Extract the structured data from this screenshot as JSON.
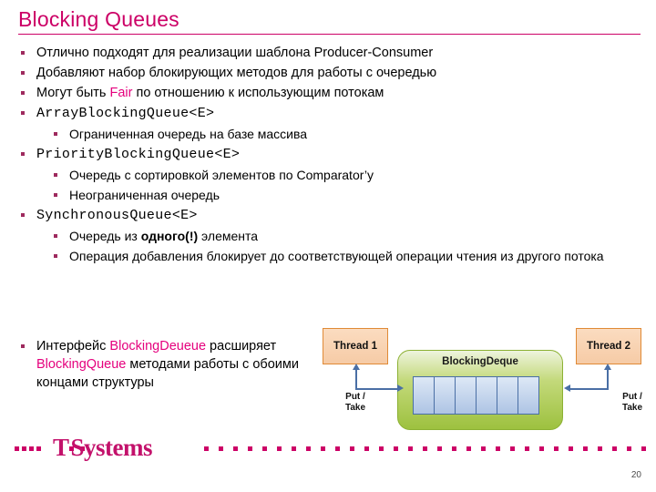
{
  "slide": {
    "title": "Blocking Queues",
    "page_number": "20",
    "accent_color": "#e5007d",
    "title_color": "#cc0066",
    "bullet_marker_color": "#9e2a5e"
  },
  "bullets": [
    {
      "level": 1,
      "style": "text",
      "text": "Отлично подходят для реализации шаблона Producer-Consumer"
    },
    {
      "level": 1,
      "style": "text",
      "text": "Добавляют набор блокирующих методов для работы с очередью"
    },
    {
      "level": 1,
      "style": "rich",
      "parts": [
        {
          "t": "Могут быть ",
          "k": "plain"
        },
        {
          "t": "Fair",
          "k": "accent"
        },
        {
          "t": " по отношению к использующим потокам",
          "k": "plain"
        }
      ]
    },
    {
      "level": 1,
      "style": "mono",
      "text": "ArrayBlockingQueue<E>"
    },
    {
      "level": 2,
      "style": "text",
      "text": "Ограниченная очередь на базе массива"
    },
    {
      "level": 1,
      "style": "mono",
      "text": "PriorityBlockingQueue<E>"
    },
    {
      "level": 2,
      "style": "text",
      "text": "Очередь с сортировкой элементов по Comparator’у"
    },
    {
      "level": 2,
      "style": "text",
      "text": "Неограниченная очередь"
    },
    {
      "level": 1,
      "style": "mono",
      "text": "SynchronousQueue<E>"
    },
    {
      "level": 2,
      "style": "rich",
      "parts": [
        {
          "t": "Очередь из ",
          "k": "plain"
        },
        {
          "t": "одного(!)",
          "k": "bold"
        },
        {
          "t": " элемента",
          "k": "plain"
        }
      ]
    },
    {
      "level": 2,
      "style": "text",
      "text": "Операция добавления блокирует до соответствующей операции чтения из другого потока"
    }
  ],
  "final_bullet": {
    "parts": [
      {
        "t": "Интерфейс ",
        "k": "plain"
      },
      {
        "t": "BlockingDeueue",
        "k": "accent"
      },
      {
        "t": " расширяет ",
        "k": "plain"
      },
      {
        "t": "BlockingQueue",
        "k": "accent"
      },
      {
        "t": " методами работы с обоими концами структуры",
        "k": "plain"
      }
    ]
  },
  "diagram": {
    "thread_left_label": "Thread 1",
    "thread_right_label": "Thread 2",
    "container_label": "BlockingDeque",
    "left_op_line1": "Put /",
    "left_op_line2": "Take",
    "right_op_line1": "Put /",
    "right_op_line2": "Take",
    "cell_count": 6,
    "thread_box_color": "#f6cba6",
    "thread_border_color": "#e08a36",
    "container_color": "#9dc13f",
    "cell_color": "#aec4e4",
    "arrow_color": "#4a6fa5"
  },
  "footer": {
    "logo_dot_prefix": "··",
    "logo_t": "T",
    "logo_mid_dots": "··",
    "logo_word": "Systems",
    "dot_color": "#cc0066"
  }
}
